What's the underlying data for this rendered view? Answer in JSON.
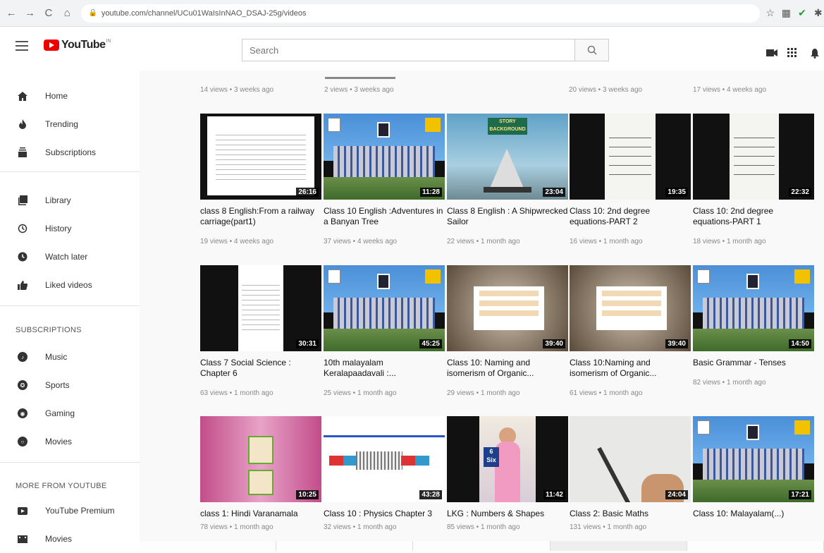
{
  "browser": {
    "url": "youtube.com/channel/UCu01WaIsInNAO_DSAJ-25g/videos"
  },
  "header": {
    "logo_text": "YouTube",
    "logo_sup": "IN",
    "search_placeholder": "Search"
  },
  "sidebar": {
    "items": [
      {
        "label": "Home",
        "icon": "home-icon"
      },
      {
        "label": "Trending",
        "icon": "fire-icon"
      },
      {
        "label": "Subscriptions",
        "icon": "subscriptions-icon"
      },
      {
        "label": "Library",
        "icon": "library-icon"
      },
      {
        "label": "History",
        "icon": "history-icon"
      },
      {
        "label": "Watch later",
        "icon": "clock-icon"
      },
      {
        "label": "Liked videos",
        "icon": "thumbs-up-icon"
      }
    ],
    "subscriptions_heading": "SUBSCRIPTIONS",
    "subscriptions": [
      {
        "label": "Music"
      },
      {
        "label": "Sports"
      },
      {
        "label": "Gaming"
      },
      {
        "label": "Movies"
      }
    ],
    "more_heading": "MORE FROM YOUTUBE",
    "more": [
      {
        "label": "YouTube Premium"
      },
      {
        "label": "Movies"
      }
    ]
  },
  "top_meta": [
    "14 views • 3 weeks ago",
    "2 views • 3 weeks ago",
    "20 views • 3 weeks ago",
    "17 views • 4 weeks ago"
  ],
  "videos": [
    {
      "title": "class 8 English:From a railway carriage(part1)",
      "meta": "19 views • 4 weeks ago",
      "duration": "26:16"
    },
    {
      "title": "Class 10 English :Adventures in a Banyan Tree",
      "meta": "37 views • 4 weeks ago",
      "duration": "11:28"
    },
    {
      "title": "Class 8 English : A Shipwrecked Sailor",
      "meta": "22 views • 1 month ago",
      "duration": "23:04",
      "thumb_text": "STORY BACKGROUND"
    },
    {
      "title": "Class 10: 2nd degree equations-PART 2",
      "meta": "16 views • 1 month ago",
      "duration": "19:35"
    },
    {
      "title": "Class 10: 2nd degree equations-PART 1",
      "meta": "18 views • 1 month ago",
      "duration": "22:32"
    },
    {
      "title": "Class 7 Social Science : Chapter 6",
      "meta": "63 views • 1 month ago",
      "duration": "30:31"
    },
    {
      "title": "10th malayalam Keralapaadavali :...",
      "meta": "25 views • 1 month ago",
      "duration": "45:25"
    },
    {
      "title": "Class 10: Naming and isomerism of Organic...",
      "meta": "29 views • 1 month ago",
      "duration": "39:40"
    },
    {
      "title": "Class 10:Naming and isomerism of Organic...",
      "meta": "61 views • 1 month ago",
      "duration": "39:40"
    },
    {
      "title": "Basic Grammar - Tenses",
      "meta": "82 views • 1 month ago",
      "duration": "14:50"
    },
    {
      "title": "class 1: Hindi Varanamala",
      "meta": "78 views • 1 month ago",
      "duration": "10:25"
    },
    {
      "title": "Class 10 : Physics Chapter 3",
      "meta": "32 views • 1 month ago",
      "duration": "43:28"
    },
    {
      "title": "LKG : Numbers & Shapes",
      "meta": "85 views • 1 month ago",
      "duration": "11:42",
      "thumb_num": "6",
      "thumb_word": "Six"
    },
    {
      "title": "Class 2: Basic Maths",
      "meta": "131 views • 1 month ago",
      "duration": "24:04"
    },
    {
      "title": "Class 10: Malayalam(...)",
      "meta": "",
      "duration": "17:21"
    }
  ]
}
